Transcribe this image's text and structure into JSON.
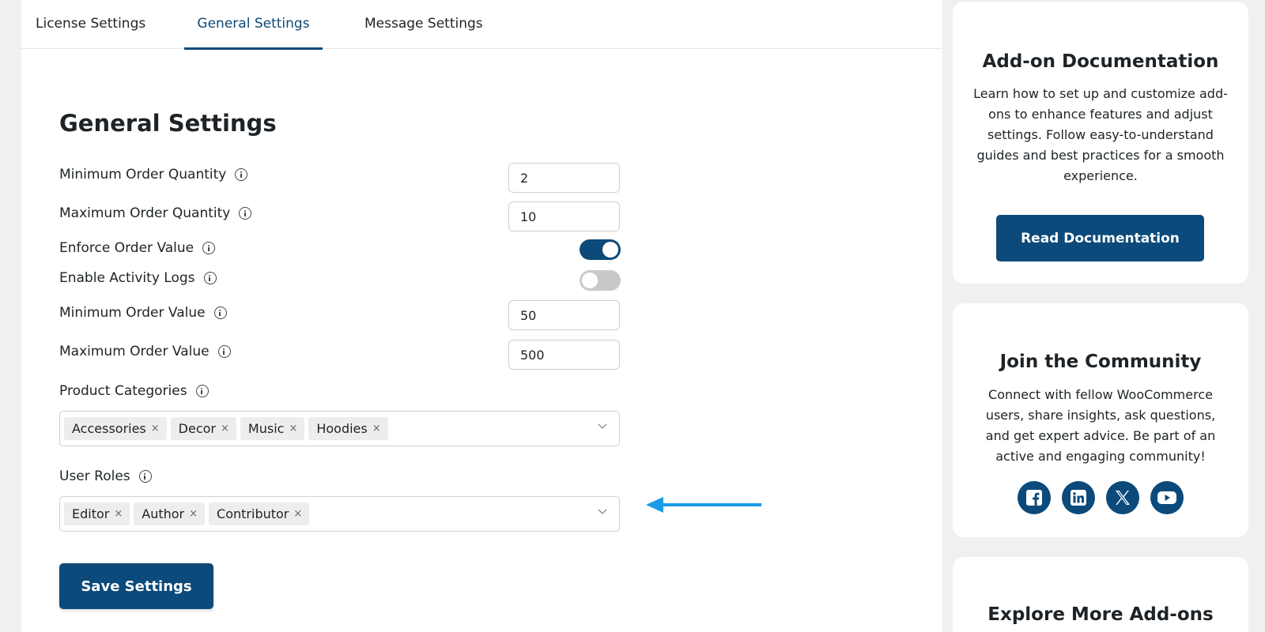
{
  "tabs": [
    "License Settings",
    "General Settings",
    "Message Settings"
  ],
  "active_tab": "General Settings",
  "page_title": "General Settings",
  "settings": {
    "min_qty": {
      "label": "Minimum Order Quantity",
      "value": "2"
    },
    "max_qty": {
      "label": "Maximum Order Quantity",
      "value": "10"
    },
    "enforce_value": {
      "label": "Enforce Order Value",
      "enabled": true
    },
    "activity_logs": {
      "label": "Enable Activity Logs",
      "enabled": false
    },
    "min_value": {
      "label": "Minimum Order Value",
      "value": "50"
    },
    "max_value": {
      "label": "Maximum Order Value",
      "value": "500"
    }
  },
  "product_categories": {
    "label": "Product Categories",
    "selected": [
      "Accessories",
      "Decor",
      "Music",
      "Hoodies"
    ]
  },
  "user_roles": {
    "label": "User Roles",
    "selected": [
      "Editor",
      "Author",
      "Contributor"
    ]
  },
  "chip_remove_symbol": "×",
  "save_label": "Save Settings",
  "docs_card": {
    "title": "Add-on Documentation",
    "text": "Learn how to set up and customize add-ons to enhance features and adjust settings. Follow easy-to-understand guides and best practices for a smooth experience.",
    "button": "Read Documentation"
  },
  "community_card": {
    "title": "Join the Community",
    "text": "Connect with fellow WooCommerce users, share insights, ask questions, and get expert advice. Be part of an active and engaging community!",
    "socials": [
      "facebook-icon",
      "linkedin-icon",
      "x-icon",
      "youtube-icon"
    ]
  },
  "more_card": {
    "title": "Explore More Add-ons"
  },
  "colors": {
    "accent": "#0b4a7a",
    "annotation_arrow": "#1a9be8",
    "toggle_off": "#c9c9c9"
  }
}
